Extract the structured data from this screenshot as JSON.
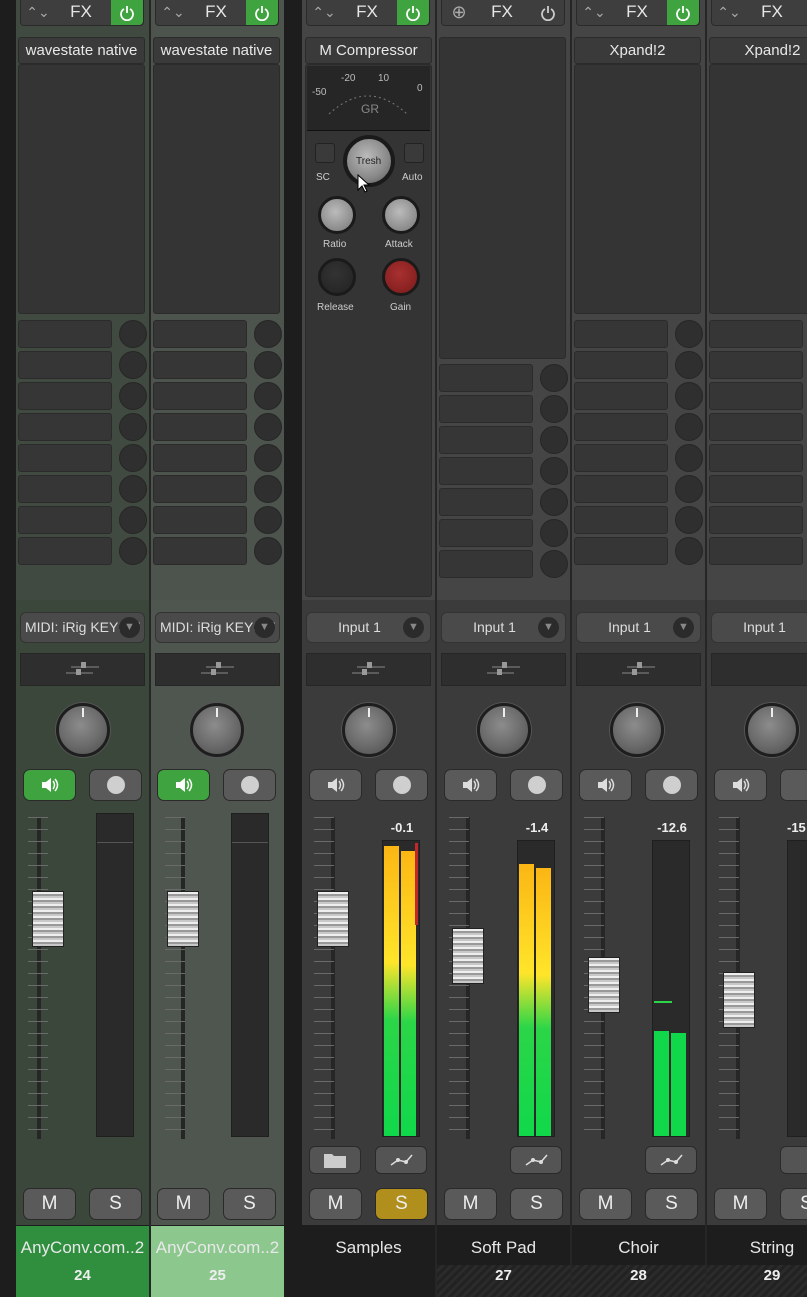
{
  "fx_label": "FX",
  "mute_label": "M",
  "solo_label": "S",
  "channels": [
    {
      "slot": "wavestate native",
      "input": "MIDI: iRig KEYS F",
      "name": "AnyConv.com..2",
      "number": "24",
      "meter": "",
      "monitor_on": true,
      "fx_on": true
    },
    {
      "slot": "wavestate native",
      "input": "MIDI: iRig KEYS F",
      "name": "AnyConv.com..2",
      "number": "25",
      "meter": "",
      "monitor_on": true,
      "fx_on": true
    },
    {
      "slot": "M Compressor",
      "input": "Input 1",
      "name": "Samples",
      "number": "",
      "meter": "-0.1",
      "monitor_on": false,
      "fx_on": true,
      "solo_on": true
    },
    {
      "slot": "",
      "input": "Input 1",
      "name": "Soft Pad",
      "number": "27",
      "meter": "-1.4",
      "monitor_on": false,
      "fx_on": false
    },
    {
      "slot": "Xpand!2",
      "input": "Input 1",
      "name": "Choir",
      "number": "28",
      "meter": "-12.6",
      "monitor_on": false,
      "fx_on": true
    },
    {
      "slot": "Xpand!2",
      "input": "Input 1",
      "name": "String",
      "number": "29",
      "meter": "-15",
      "monitor_on": false,
      "fx_on": false
    }
  ],
  "compressor": {
    "scale": [
      "-50",
      "-20",
      "10",
      "0"
    ],
    "gr_label": "GR",
    "sc": "SC",
    "auto": "Auto",
    "tresh": "Tresh",
    "ratio": "Ratio",
    "attack": "Attack",
    "release": "Release",
    "gain": "Gain"
  },
  "colors": {
    "green": "#3fa33f",
    "solo_yellow": "#b08f1c",
    "meter_green": "#10d84a",
    "meter_yellow": "#ffe52a",
    "meter_orange": "#fbb614",
    "gain_knob_red": "#8b1f1f"
  }
}
